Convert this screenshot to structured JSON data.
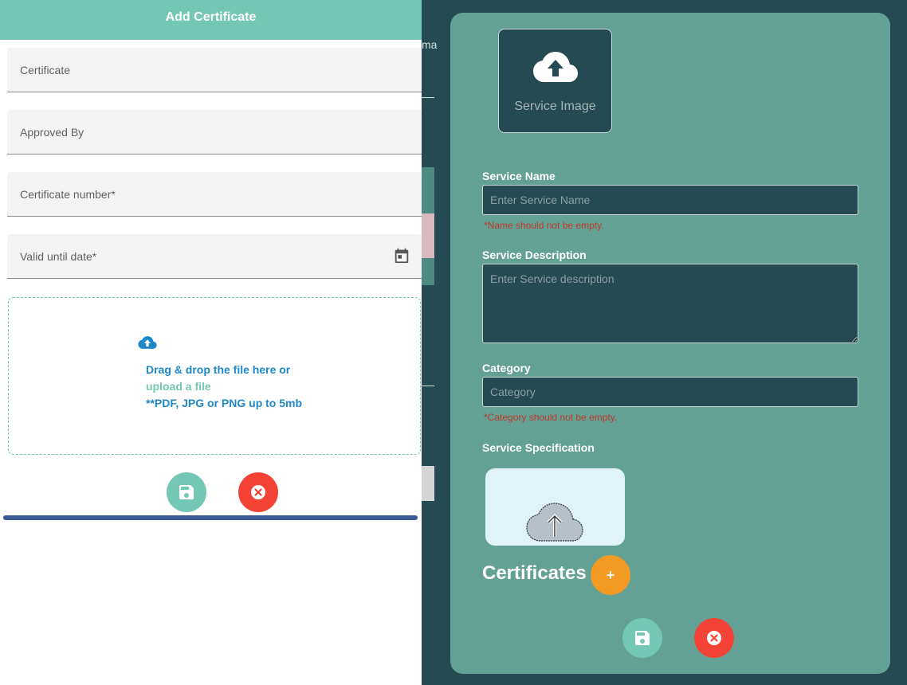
{
  "background": {
    "cut_text": "ma"
  },
  "service_form": {
    "image_label": "Service Image",
    "name_label": "Service Name",
    "name_placeholder": "Enter Service Name",
    "name_error": "*Name should not be empty.",
    "description_label": "Service Description",
    "description_placeholder": "Enter Service description",
    "category_label": "Category",
    "category_placeholder": "Category",
    "category_error": "*Category should not be empty.",
    "specification_label": "Service Specification",
    "certificates_title": "Certificates",
    "add_certificate_glyph": "+"
  },
  "certificate_drawer": {
    "title": "Add Certificate",
    "fields": {
      "certificate": "Certificate",
      "approved_by": "Approved By",
      "certificate_number": "Certificate number*",
      "valid_until": "Valid until date*"
    },
    "dropzone": {
      "line1": "Drag & drop the file here or",
      "link": "upload a file",
      "hint": "**PDF, JPG or PNG up to 5mb"
    }
  },
  "icons": {
    "upload": "cloud-upload-icon",
    "calendar": "calendar-icon",
    "save": "floppy-disk-icon",
    "cancel": "close-circle-icon"
  },
  "colors": {
    "accent_teal": "#74c6b5",
    "panel_bg": "#63a195",
    "dark_bg": "#234b51",
    "cancel_red": "#f44336",
    "add_orange": "#f39a25",
    "link_blue": "#1e88c8",
    "error_red": "#c0392b"
  }
}
